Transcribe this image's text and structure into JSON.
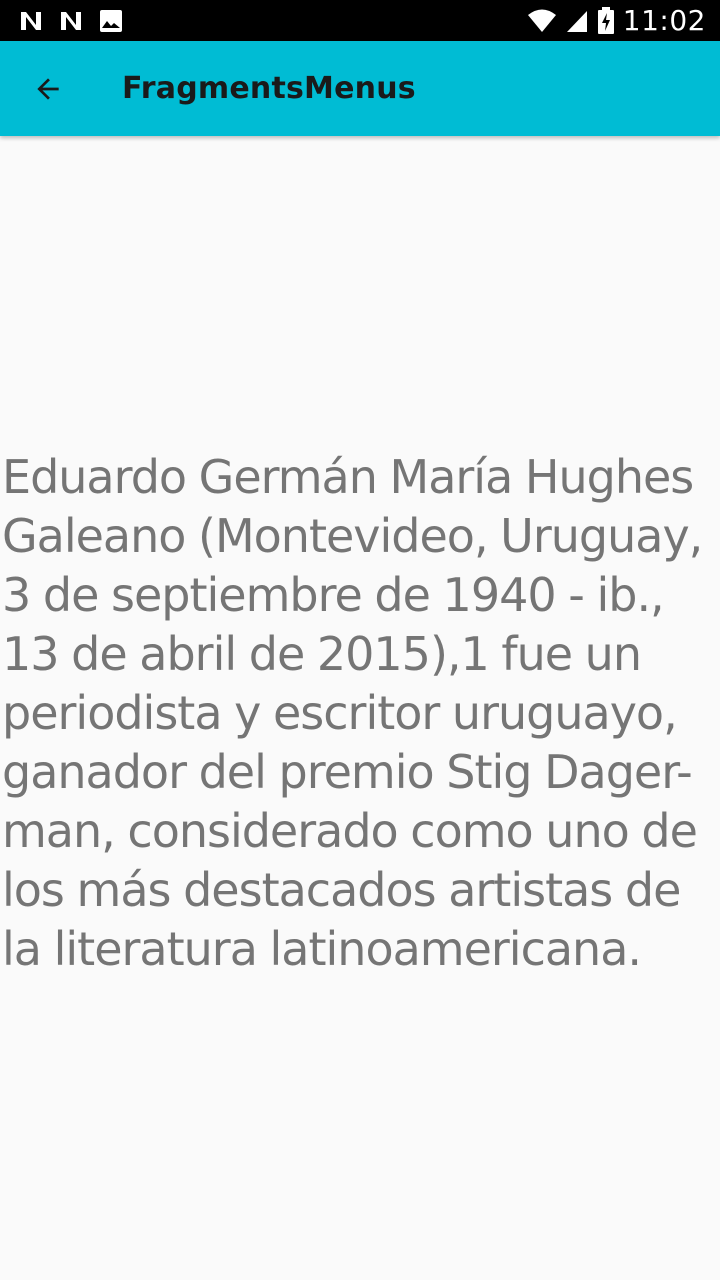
{
  "status_bar": {
    "time": "11:02",
    "left_icons": [
      "notification-n-icon",
      "notification-n-icon",
      "image-icon"
    ],
    "right_icons": [
      "wifi-icon",
      "cell-signal-icon",
      "battery-charging-icon"
    ]
  },
  "app_bar": {
    "title": "FragmentsMenus",
    "back_icon": "arrow-back-icon",
    "background_color": "#00BCD4"
  },
  "content": {
    "text": "Eduardo Germán María Hughes Galeano (Montevideo, Uruguay, 3 de septiembre de 1940 - ib., 13 de abril de 2015),1 fue un periodista y escritor uruguayo, ganador del premio Stig Dager-man, considerado como uno de los más destacados artistas de la literatura latinoamericana.",
    "text_color": "#757575"
  }
}
